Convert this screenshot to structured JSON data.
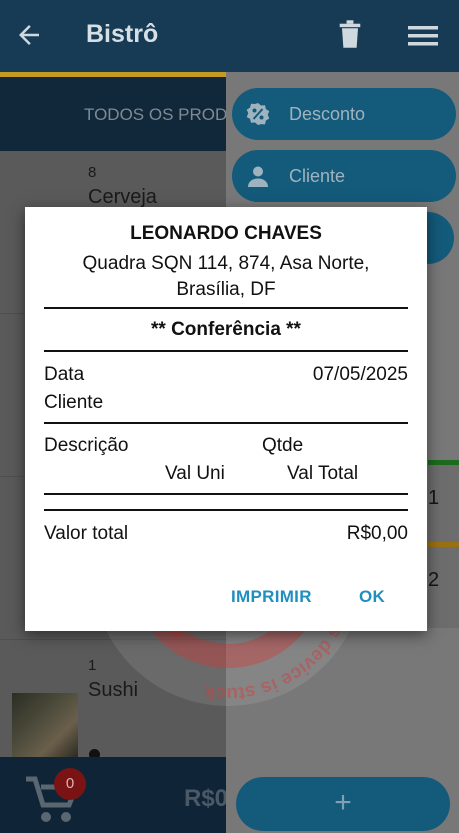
{
  "appbar": {
    "title": "Bistrô"
  },
  "tabs": {
    "label": "TODOS OS PRODUTOS"
  },
  "list": {
    "items": [
      {
        "qty": "8",
        "name": "Cerveja"
      },
      {
        "qty": "1",
        "name": "Sushi"
      }
    ]
  },
  "cart": {
    "badge": "0",
    "total_partial": "R$0"
  },
  "side_menu": {
    "items": [
      {
        "label": "Desconto",
        "icon": "percent-badge-icon"
      },
      {
        "label": "Cliente",
        "icon": "person-icon"
      }
    ],
    "cards": [
      {
        "text": "1",
        "color": "#1d6b1d"
      },
      {
        "text": "2",
        "color": "#9a7112"
      }
    ],
    "fab_label": "+"
  },
  "watermark": {
    "text": "Don't deal | This device is stuck Don't deal | This device is stuck"
  },
  "receipt": {
    "store_name": "LEONARDO CHAVES",
    "address_line1": "Quadra SQN 114, 874, Asa Norte,",
    "address_line2": "Brasília, DF",
    "heading": "** Conferência **",
    "date_label": "Data",
    "date_value": "07/05/2025",
    "client_label": "Cliente",
    "col_description": "Descrição",
    "col_qty": "Qtde",
    "col_unit": "Val Uni",
    "col_total": "Val Total",
    "total_label": "Valor total",
    "total_value": "R$0,00",
    "print_button": "IMPRIMIR",
    "ok_button": "OK"
  }
}
